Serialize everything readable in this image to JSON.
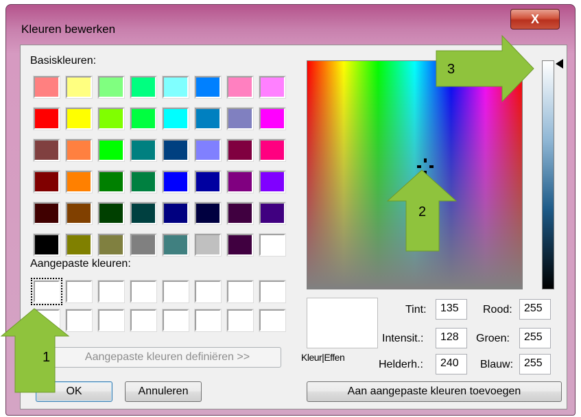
{
  "window": {
    "title": "Kleuren bewerken",
    "close_glyph": "X"
  },
  "basic": {
    "label": "Basiskleuren:",
    "colors": [
      [
        "#ff8080",
        "#ffff80",
        "#80ff80",
        "#00ff80",
        "#80ffff",
        "#0080ff",
        "#ff80c0",
        "#ff80ff"
      ],
      [
        "#ff0000",
        "#ffff00",
        "#80ff00",
        "#00ff40",
        "#00ffff",
        "#0080c0",
        "#8080c0",
        "#ff00ff"
      ],
      [
        "#804040",
        "#ff8040",
        "#00ff00",
        "#008080",
        "#004080",
        "#8080ff",
        "#800040",
        "#ff0080"
      ],
      [
        "#800000",
        "#ff8000",
        "#008000",
        "#008040",
        "#0000ff",
        "#0000a0",
        "#800080",
        "#8000ff"
      ],
      [
        "#400000",
        "#804000",
        "#004000",
        "#004040",
        "#000080",
        "#000040",
        "#400040",
        "#400080"
      ],
      [
        "#000000",
        "#808000",
        "#808040",
        "#808080",
        "#408080",
        "#c0c0c0",
        "#400040",
        "#ffffff"
      ]
    ]
  },
  "custom": {
    "label": "Aangepaste kleuren:"
  },
  "buttons": {
    "define": "Aangepaste kleuren definiëren >>",
    "ok": "OK",
    "cancel": "Annuleren",
    "add": "Aan aangepaste kleuren toevoegen"
  },
  "preview": {
    "label": "Kleur|Effen"
  },
  "hsl": {
    "hue_label": "Tint:",
    "hue": "135",
    "sat_label": "Intensit.:",
    "sat": "128",
    "lum_label": "Helderh.:",
    "lum": "240"
  },
  "rgb": {
    "red_label": "Rood:",
    "red": "255",
    "green_label": "Groen:",
    "green": "255",
    "blue_label": "Blauw:",
    "blue": "255"
  },
  "annotations": {
    "one": "1",
    "two": "2",
    "three": "3",
    "arrow_color": "#8fc33d"
  }
}
